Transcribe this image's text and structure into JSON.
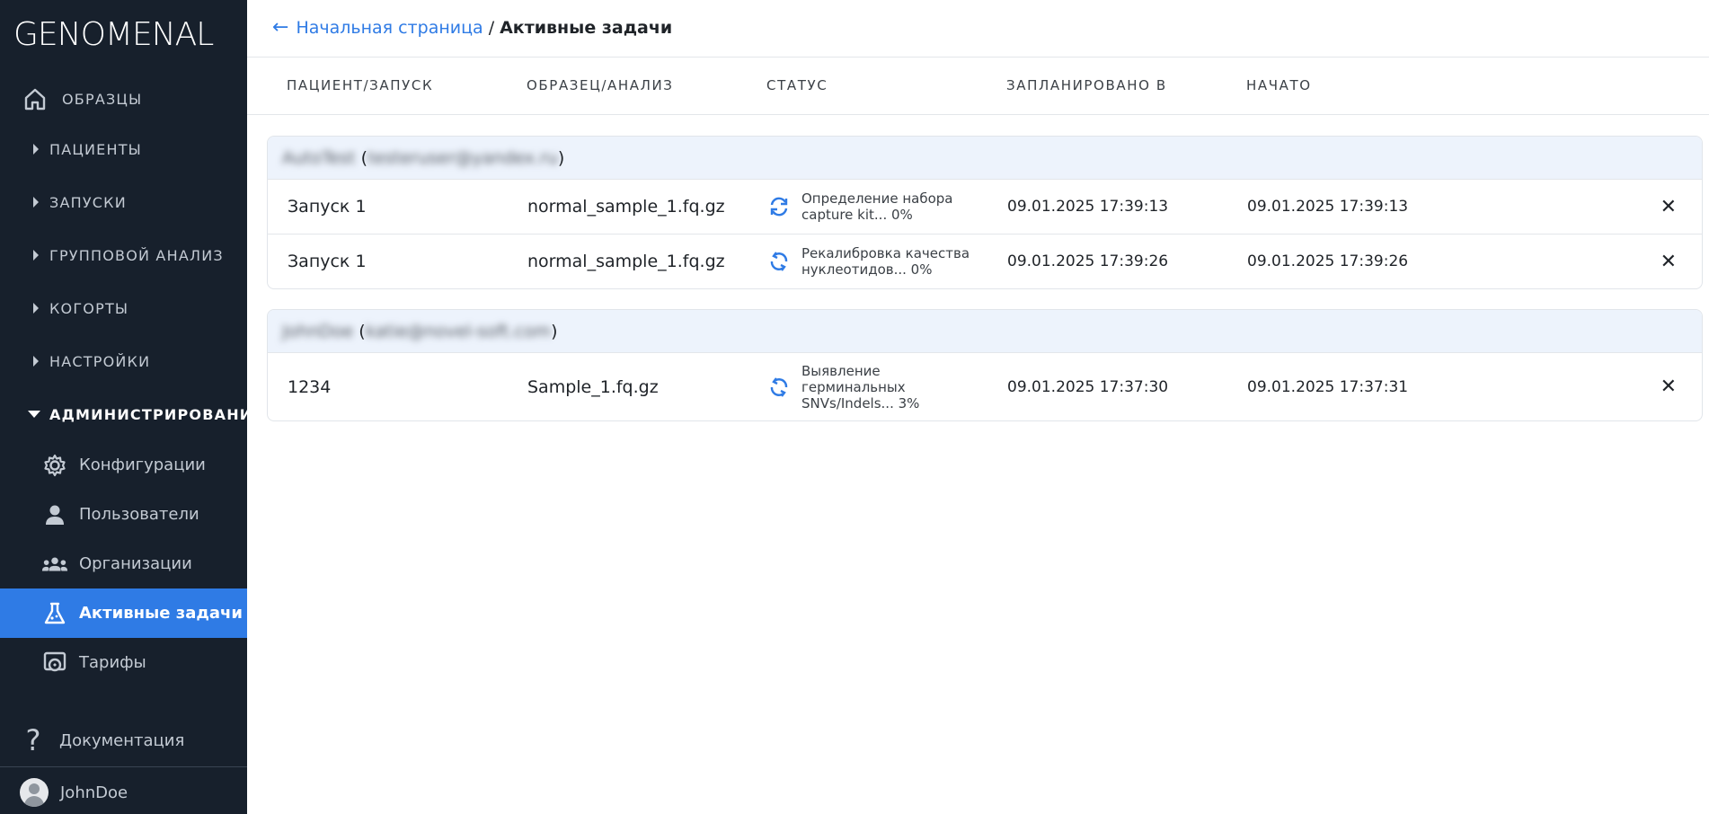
{
  "app": {
    "logo": "GENOMENAL"
  },
  "sidebar": {
    "home": {
      "label": "ОБРАЗЦЫ",
      "icon": "home-icon"
    },
    "sections": [
      {
        "label": "ПАЦИЕНТЫ"
      },
      {
        "label": "ЗАПУСКИ"
      },
      {
        "label": "ГРУППОВОЙ АНАЛИЗ"
      },
      {
        "label": "КОГОРТЫ"
      },
      {
        "label": "НАСТРОЙКИ"
      }
    ],
    "admin": {
      "label": "АДМИНИСТРИРОВАНИЕ",
      "items": [
        {
          "label": "Конфигурации",
          "icon": "gear-icon"
        },
        {
          "label": "Пользователи",
          "icon": "user-icon"
        },
        {
          "label": "Организации",
          "icon": "group-icon"
        },
        {
          "label": "Активные задачи",
          "icon": "flask-icon",
          "active": true
        },
        {
          "label": "Тарифы",
          "icon": "tariff-icon"
        }
      ]
    },
    "docs": {
      "label": "Документация",
      "icon": "question-icon"
    },
    "user": {
      "label": "JohnDoe",
      "icon": "avatar-icon"
    }
  },
  "breadcrumb": {
    "home": "Начальная страница",
    "separator": "/",
    "current": "Активные задачи"
  },
  "table": {
    "columns": [
      "ПАЦИЕНТ/ЗАПУСК",
      "ОБРАЗЕЦ/АНАЛИЗ",
      "СТАТУС",
      "ЗАПЛАНИРОВАНО В",
      "НАЧАТО"
    ],
    "groups": [
      {
        "user": "AutoTest",
        "email": "testeruser@yandex.ru",
        "rows": [
          {
            "run": "Запуск 1",
            "sample": "normal_sample_1.fq.gz",
            "status": "Определение набора capture kit... 0%",
            "scheduled": "09.01.2025 17:39:13",
            "started": "09.01.2025 17:39:13"
          },
          {
            "run": "Запуск 1",
            "sample": "normal_sample_1.fq.gz",
            "status": "Рекалибровка качества нуклеотидов... 0%",
            "scheduled": "09.01.2025 17:39:26",
            "started": "09.01.2025 17:39:26"
          }
        ]
      },
      {
        "user": "JohnDoe",
        "email": "katie@novel-soft.com",
        "rows": [
          {
            "run": "1234",
            "sample": "Sample_1.fq.gz",
            "status": "Выявление герминальных SNVs/Indels... 3%",
            "scheduled": "09.01.2025 17:37:30",
            "started": "09.01.2025 17:37:31"
          }
        ]
      }
    ]
  },
  "colors": {
    "accent": "#2f7be5",
    "sidebar_bg": "#17202c",
    "group_header_bg": "#edf3fc"
  }
}
